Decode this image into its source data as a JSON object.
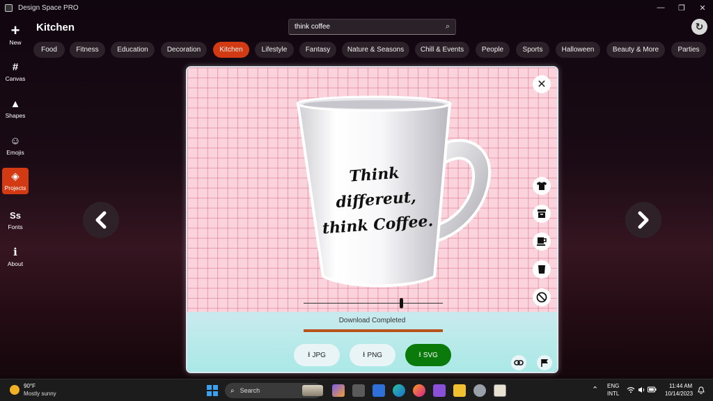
{
  "window": {
    "title": "Design Space PRO",
    "minimize_glyph": "—",
    "maximize_glyph": "❐",
    "close_glyph": "✕"
  },
  "sidebar": {
    "items": [
      {
        "label": "New",
        "icon": "plus-icon",
        "glyph": "+"
      },
      {
        "label": "Canvas",
        "icon": "grid-icon",
        "glyph": "#"
      },
      {
        "label": "Shapes",
        "icon": "shapes-icon",
        "glyph": "▲"
      },
      {
        "label": "Emojis",
        "icon": "smiley-icon",
        "glyph": "☺"
      },
      {
        "label": "Projects",
        "icon": "layers-icon",
        "glyph": "◈"
      },
      {
        "label": "Fonts",
        "icon": "font-icon",
        "glyph": "Ss"
      },
      {
        "label": "About",
        "icon": "info-icon",
        "glyph": "ℹ"
      }
    ],
    "active_index": 4
  },
  "header": {
    "title": "Kitchen",
    "search_value": "think coffee",
    "search_icon": "⌕",
    "refresh_glyph": "↻"
  },
  "categories": [
    "Food",
    "Fitness",
    "Education",
    "Decoration",
    "Kitchen",
    "Lifestyle",
    "Fantasy",
    "Nature & Seasons",
    "Chill & Events",
    "People",
    "Sports",
    "Halloween",
    "Beauty & More",
    "Parties"
  ],
  "active_category_index": 4,
  "preview": {
    "mug_text_line1": "Think differeut,",
    "mug_text_line2": "think Coffee.",
    "close_glyph": "✕",
    "tools": [
      "tshirt-icon",
      "box-icon",
      "mug-icon",
      "cup-icon",
      "ban-icon"
    ],
    "slider_value": 0.7,
    "status": "Download Completed",
    "progress": 1.0,
    "download_buttons": [
      {
        "label": "JPG",
        "primary": false
      },
      {
        "label": "PNG",
        "primary": false
      },
      {
        "label": "SVG",
        "primary": true
      }
    ],
    "download_glyph": "⭳"
  },
  "colors": {
    "accent": "#d23a13",
    "primary_download": "#0a7a0a",
    "progress": "#b9521a"
  },
  "taskbar": {
    "weather_temp": "90°F",
    "weather_desc": "Mostly sunny",
    "search_label": "Search",
    "language_line1": "ENG",
    "language_line2": "INTL",
    "time": "11:44 AM",
    "date": "10/14/2023",
    "tray_chevron": "⌃"
  }
}
